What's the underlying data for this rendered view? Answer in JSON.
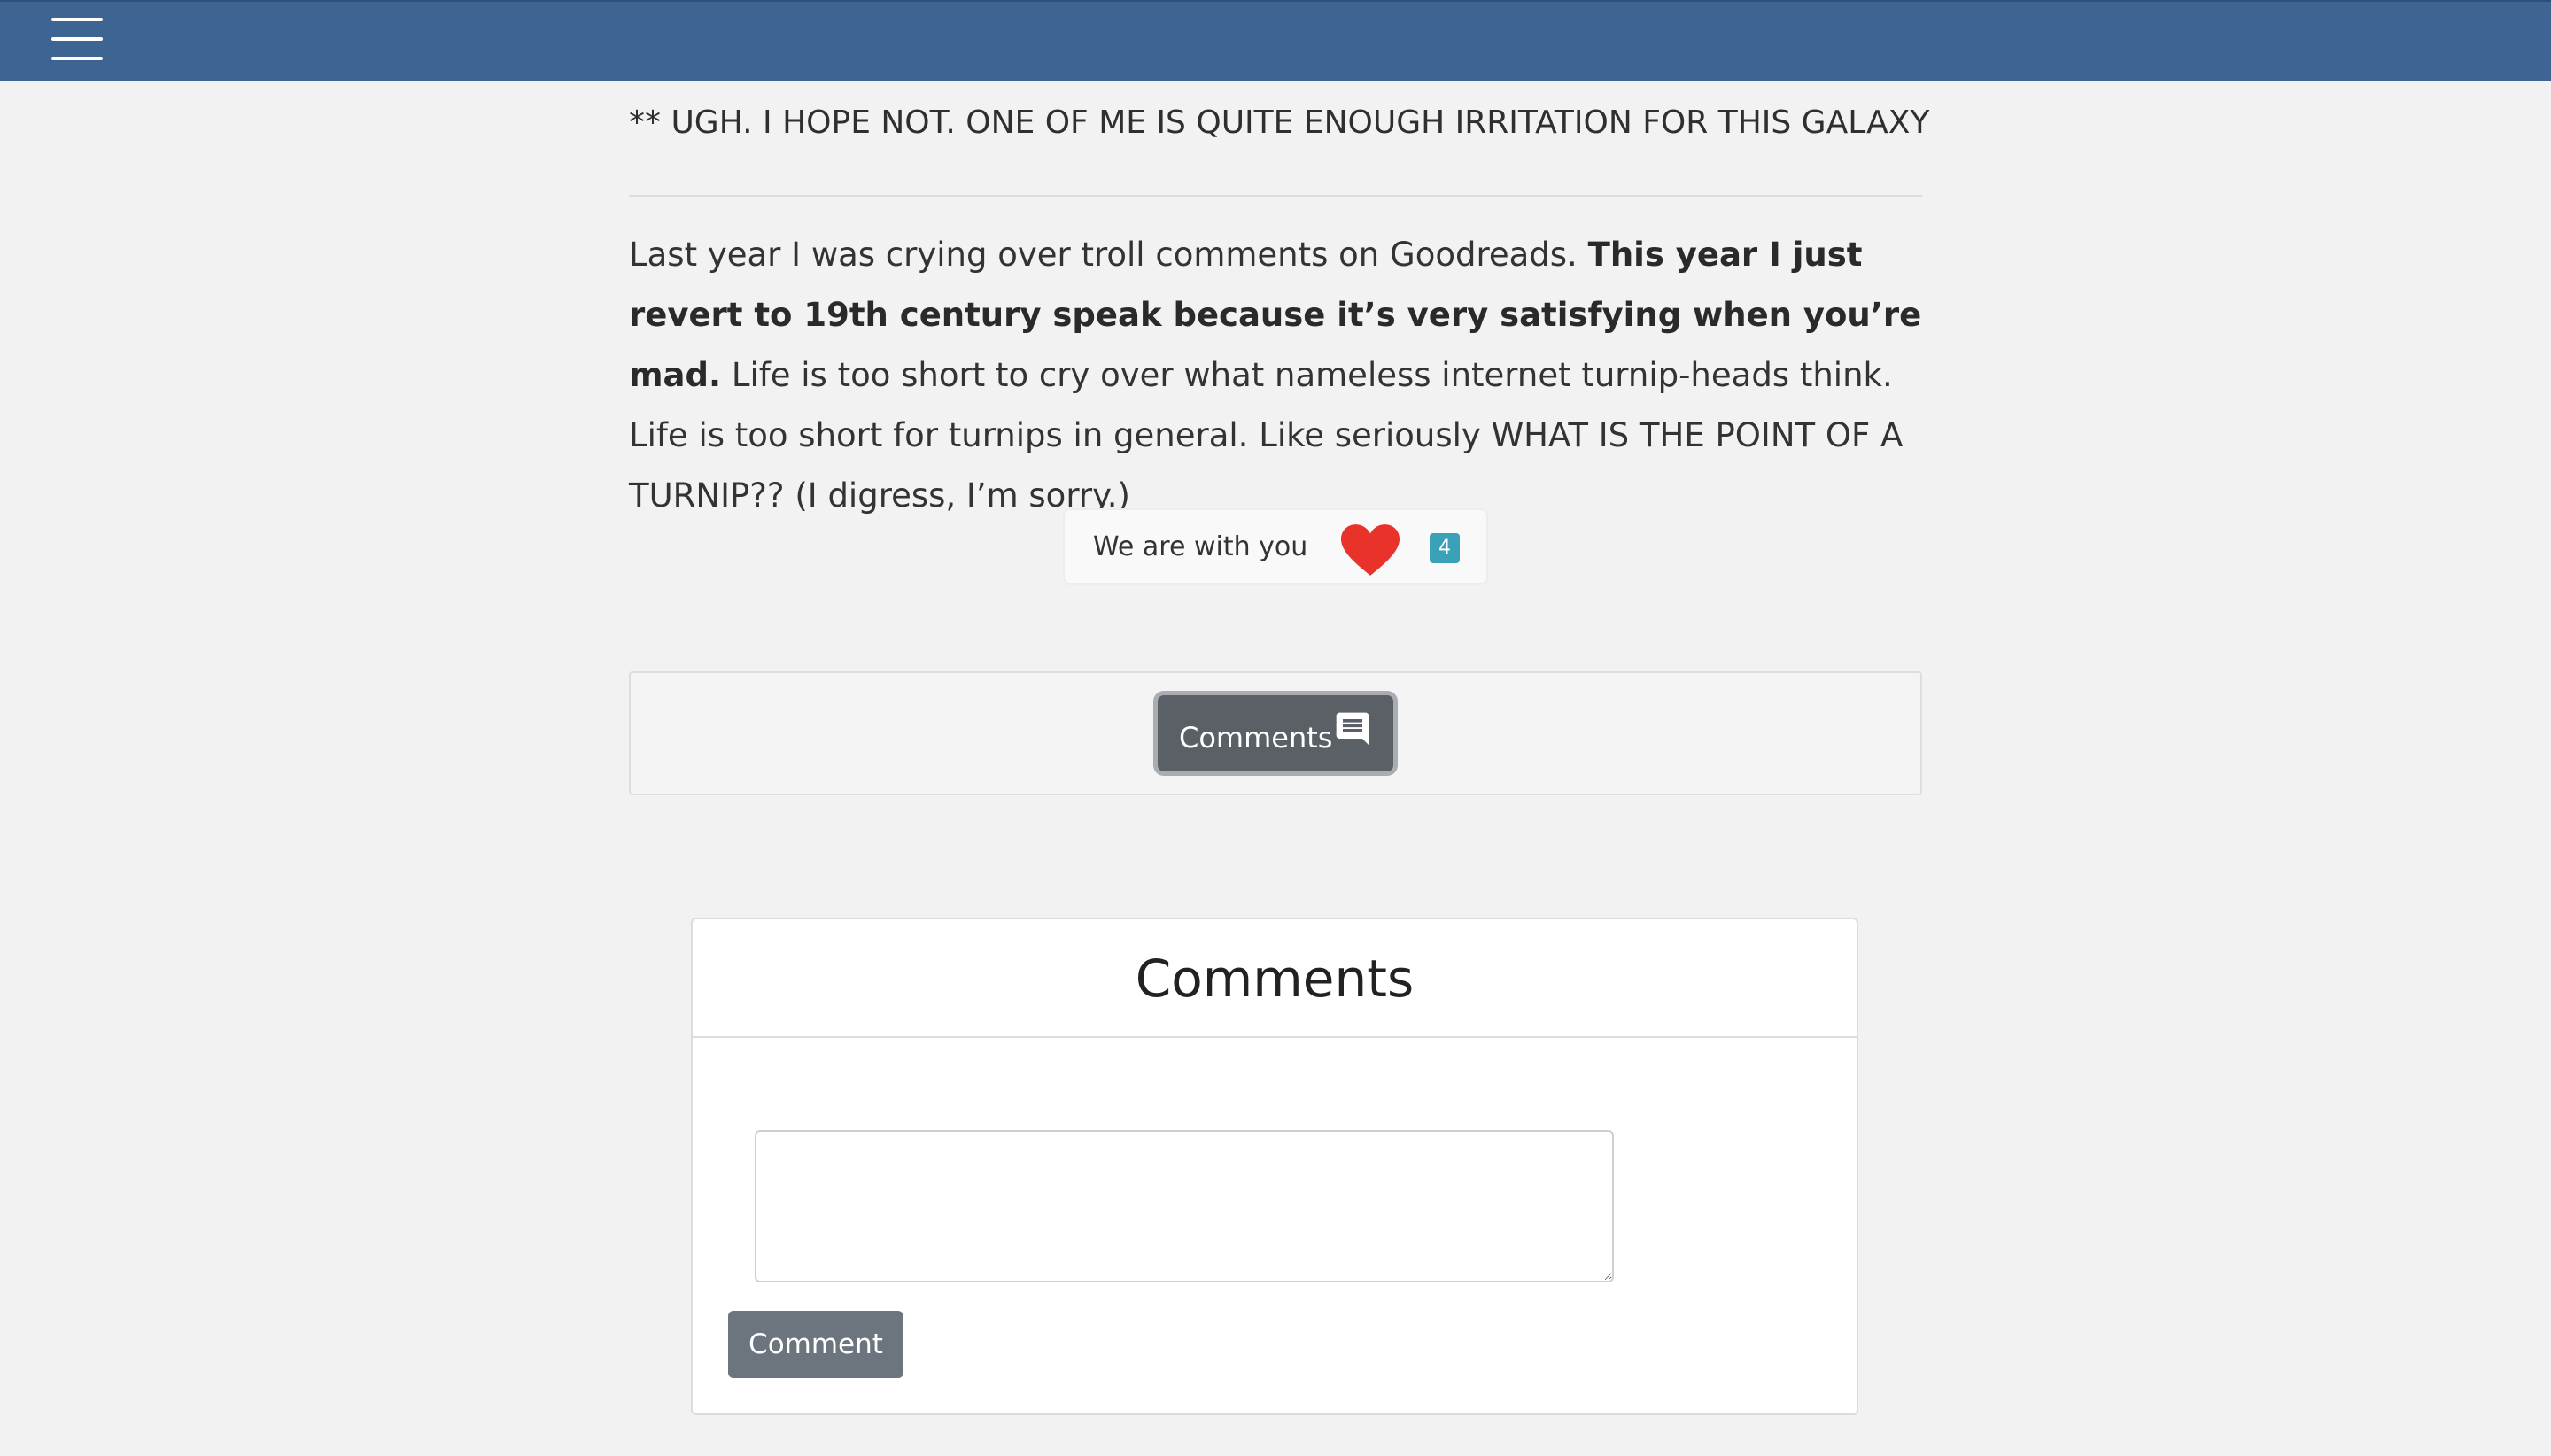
{
  "nav": {
    "menu_icon": "hamburger-menu-icon",
    "bar_color": "#3e6494"
  },
  "article": {
    "galaxy_line": "** UGH. I HOPE NOT. ONE OF ME IS QUITE ENOUGH IRRITATION FOR THIS GALAXY",
    "paragraph": {
      "part1": "Last year I was crying over troll comments on Goodreads. ",
      "bold": "This year I just revert to 19th century speak because it’s very satisfying when you’re mad.",
      "part2": " Life is too short to cry over what nameless internet turnip-heads think. Life is too short for turnips in general. Like seriously WHAT IS THE POINT OF A TURNIP?? (I digress, I’m sorry.)"
    }
  },
  "reaction": {
    "label": "We are with you",
    "icon": "heart-icon",
    "count": "4",
    "heart_color": "#e8322a",
    "badge_color": "#3aa1b8"
  },
  "comments_toggle": {
    "label": "Comments",
    "icon": "comment-icon"
  },
  "comments_section": {
    "title": "Comments",
    "textarea_placeholder": "",
    "submit_label": "Comment"
  }
}
